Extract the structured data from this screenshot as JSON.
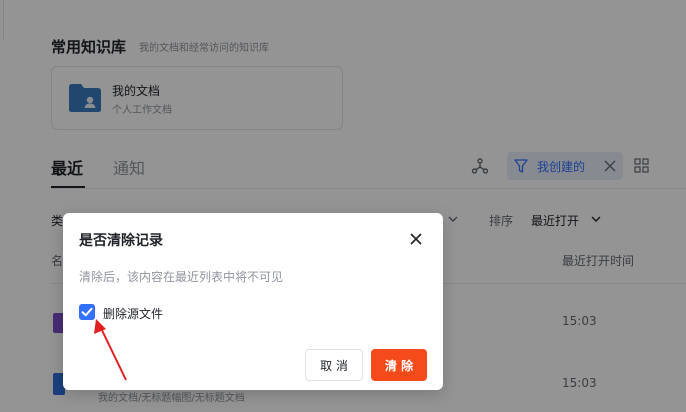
{
  "knowledge": {
    "title": "常用知识库",
    "subtitle": "我的文档和经常访问的知识库",
    "card": {
      "name": "我的文档",
      "desc": "个人工作文档"
    }
  },
  "tabs": [
    {
      "label": "最近"
    },
    {
      "label": "通知"
    }
  ],
  "filter": {
    "label": "我创建的"
  },
  "list": {
    "type_label": "类",
    "name_header": "名",
    "sort_label": "排序",
    "sort_value": "最近打开",
    "time_header": "最近打开时间",
    "rows": [
      {
        "time": "15:03"
      },
      {
        "time": "15:03",
        "path": "我的文档/无标题幅图/无标题文档"
      }
    ]
  },
  "dialog": {
    "title": "是否清除记录",
    "description": "清除后，该内容在最近列表中将不可见",
    "checkbox_label": "删除源文件",
    "checkbox_checked": true,
    "cancel_label": "取 消",
    "confirm_label": "清 除"
  },
  "colors": {
    "accent": "#3370ff",
    "danger": "#f54a1a",
    "folder": "#3b7ac0",
    "arrow": "#e02020"
  }
}
